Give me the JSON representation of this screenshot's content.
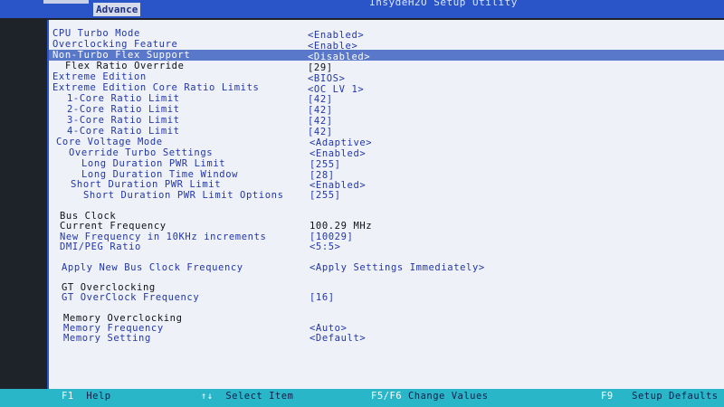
{
  "header": {
    "title": "InsydeH2O Setup Utility",
    "active_tab": "Advance"
  },
  "rows": [
    {
      "label": "CPU Turbo Mode",
      "value": "<Enabled>"
    },
    {
      "label": "Overclocking Feature",
      "value": "<Enable>"
    },
    {
      "label": "Non-Turbo Flex Support",
      "value": "<Disabled>",
      "selected": true
    },
    {
      "label": "Flex Ratio Override",
      "value": "[29]"
    },
    {
      "label": "Extreme Edition",
      "value": "<BIOS>"
    },
    {
      "label": "Extreme Edition Core Ratio Limits",
      "value": "<OC LV 1>"
    },
    {
      "label": "1-Core Ratio Limit",
      "value": "[42]"
    },
    {
      "label": "2-Core Ratio Limit",
      "value": "[42]"
    },
    {
      "label": "3-Core Ratio Limit",
      "value": "[42]"
    },
    {
      "label": "4-Core Ratio Limit",
      "value": "[42]"
    },
    {
      "label": "Core Voltage Mode",
      "value": "<Adaptive>"
    },
    {
      "label": "Override Turbo Settings",
      "value": "<Enabled>"
    },
    {
      "label": "Long Duration PWR Limit",
      "value": "[255]"
    },
    {
      "label": "Long Duration Time Window",
      "value": "[28]"
    },
    {
      "label": "Short Duration PWR Limit",
      "value": "<Enabled>"
    },
    {
      "label": "Short Duration PWR Limit Options",
      "value": "[255]"
    },
    {
      "label": "Bus Clock",
      "value": ""
    },
    {
      "label": "Current Frequency",
      "value": "100.29 MHz"
    },
    {
      "label": "New Frequency in 10KHz increments",
      "value": "[10029]"
    },
    {
      "label": "DMI/PEG Ratio",
      "value": "<5:5>"
    },
    {
      "label": "Apply New Bus Clock Frequency",
      "value": "<Apply Settings Immediately>"
    },
    {
      "label": "GT Overclocking",
      "value": ""
    },
    {
      "label": "GT OverClock Frequency",
      "value": "[16]"
    },
    {
      "label": "Memory Overclocking",
      "value": ""
    },
    {
      "label": "Memory Frequency",
      "value": "<Auto>"
    },
    {
      "label": "Memory Setting",
      "value": "<Default>"
    }
  ],
  "footer": {
    "f1_key": "F1",
    "f1_label": "Help",
    "updown_key": "↑↓",
    "updown_label": "Select Item",
    "f5f6_key": "F5/F6",
    "f5f6_label": "Change Values",
    "f9_key": "F9",
    "f9_label": "Setup Defaults"
  },
  "colors": {
    "header_bar": "#2a55c8",
    "footer_bar": "#29b6c9",
    "item_text": "#2236a8",
    "highlight_bar": "#5a78ca"
  }
}
